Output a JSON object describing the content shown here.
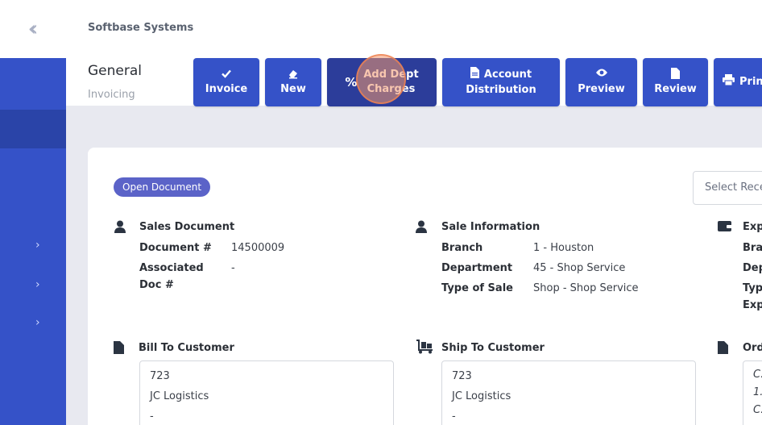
{
  "header": {
    "brand": "Softbase Systems"
  },
  "page": {
    "title": "General",
    "subtitle": "Invoicing"
  },
  "toolbar": {
    "invoice": "Invoice",
    "new": "New",
    "add_dept_1": "Add Dept",
    "add_dept_2": "Charges",
    "account_1": "Account",
    "account_2": "Distribution",
    "preview": "Preview",
    "review": "Review",
    "print": "Prin"
  },
  "card": {
    "badge": "Open Document",
    "select_placeholder": "Select Rece"
  },
  "sales_document": {
    "title": "Sales Document",
    "doc_num_label": "Document #",
    "doc_num_value": "14500009",
    "assoc_label_1": "Associated",
    "assoc_label_2": "Doc #",
    "assoc_value": "-"
  },
  "sale_information": {
    "title": "Sale Information",
    "branch_label": "Branch",
    "branch_value": "1 - Houston",
    "dept_label": "Department",
    "dept_value": "45 - Shop Service",
    "type_label": "Type of Sale",
    "type_value": "Shop - Shop Service"
  },
  "third_section": {
    "title": "Exp",
    "line1": "Bra",
    "line2": "Dep",
    "line3": "Typ",
    "line4": "Exp"
  },
  "bill_to": {
    "title": "Bill To Customer",
    "line1": "723",
    "line2": "JC Logistics",
    "line3": "-"
  },
  "ship_to": {
    "title": "Ship To Customer",
    "line1": "723",
    "line2": "JC Logistics",
    "line3": "-"
  },
  "order": {
    "title": "Ord",
    "line1": "C.",
    "line2": "1.",
    "line3": "C."
  },
  "colors": {
    "accent": "#3552c8",
    "badge": "#5b63c8",
    "highlight": "#f2986e"
  }
}
